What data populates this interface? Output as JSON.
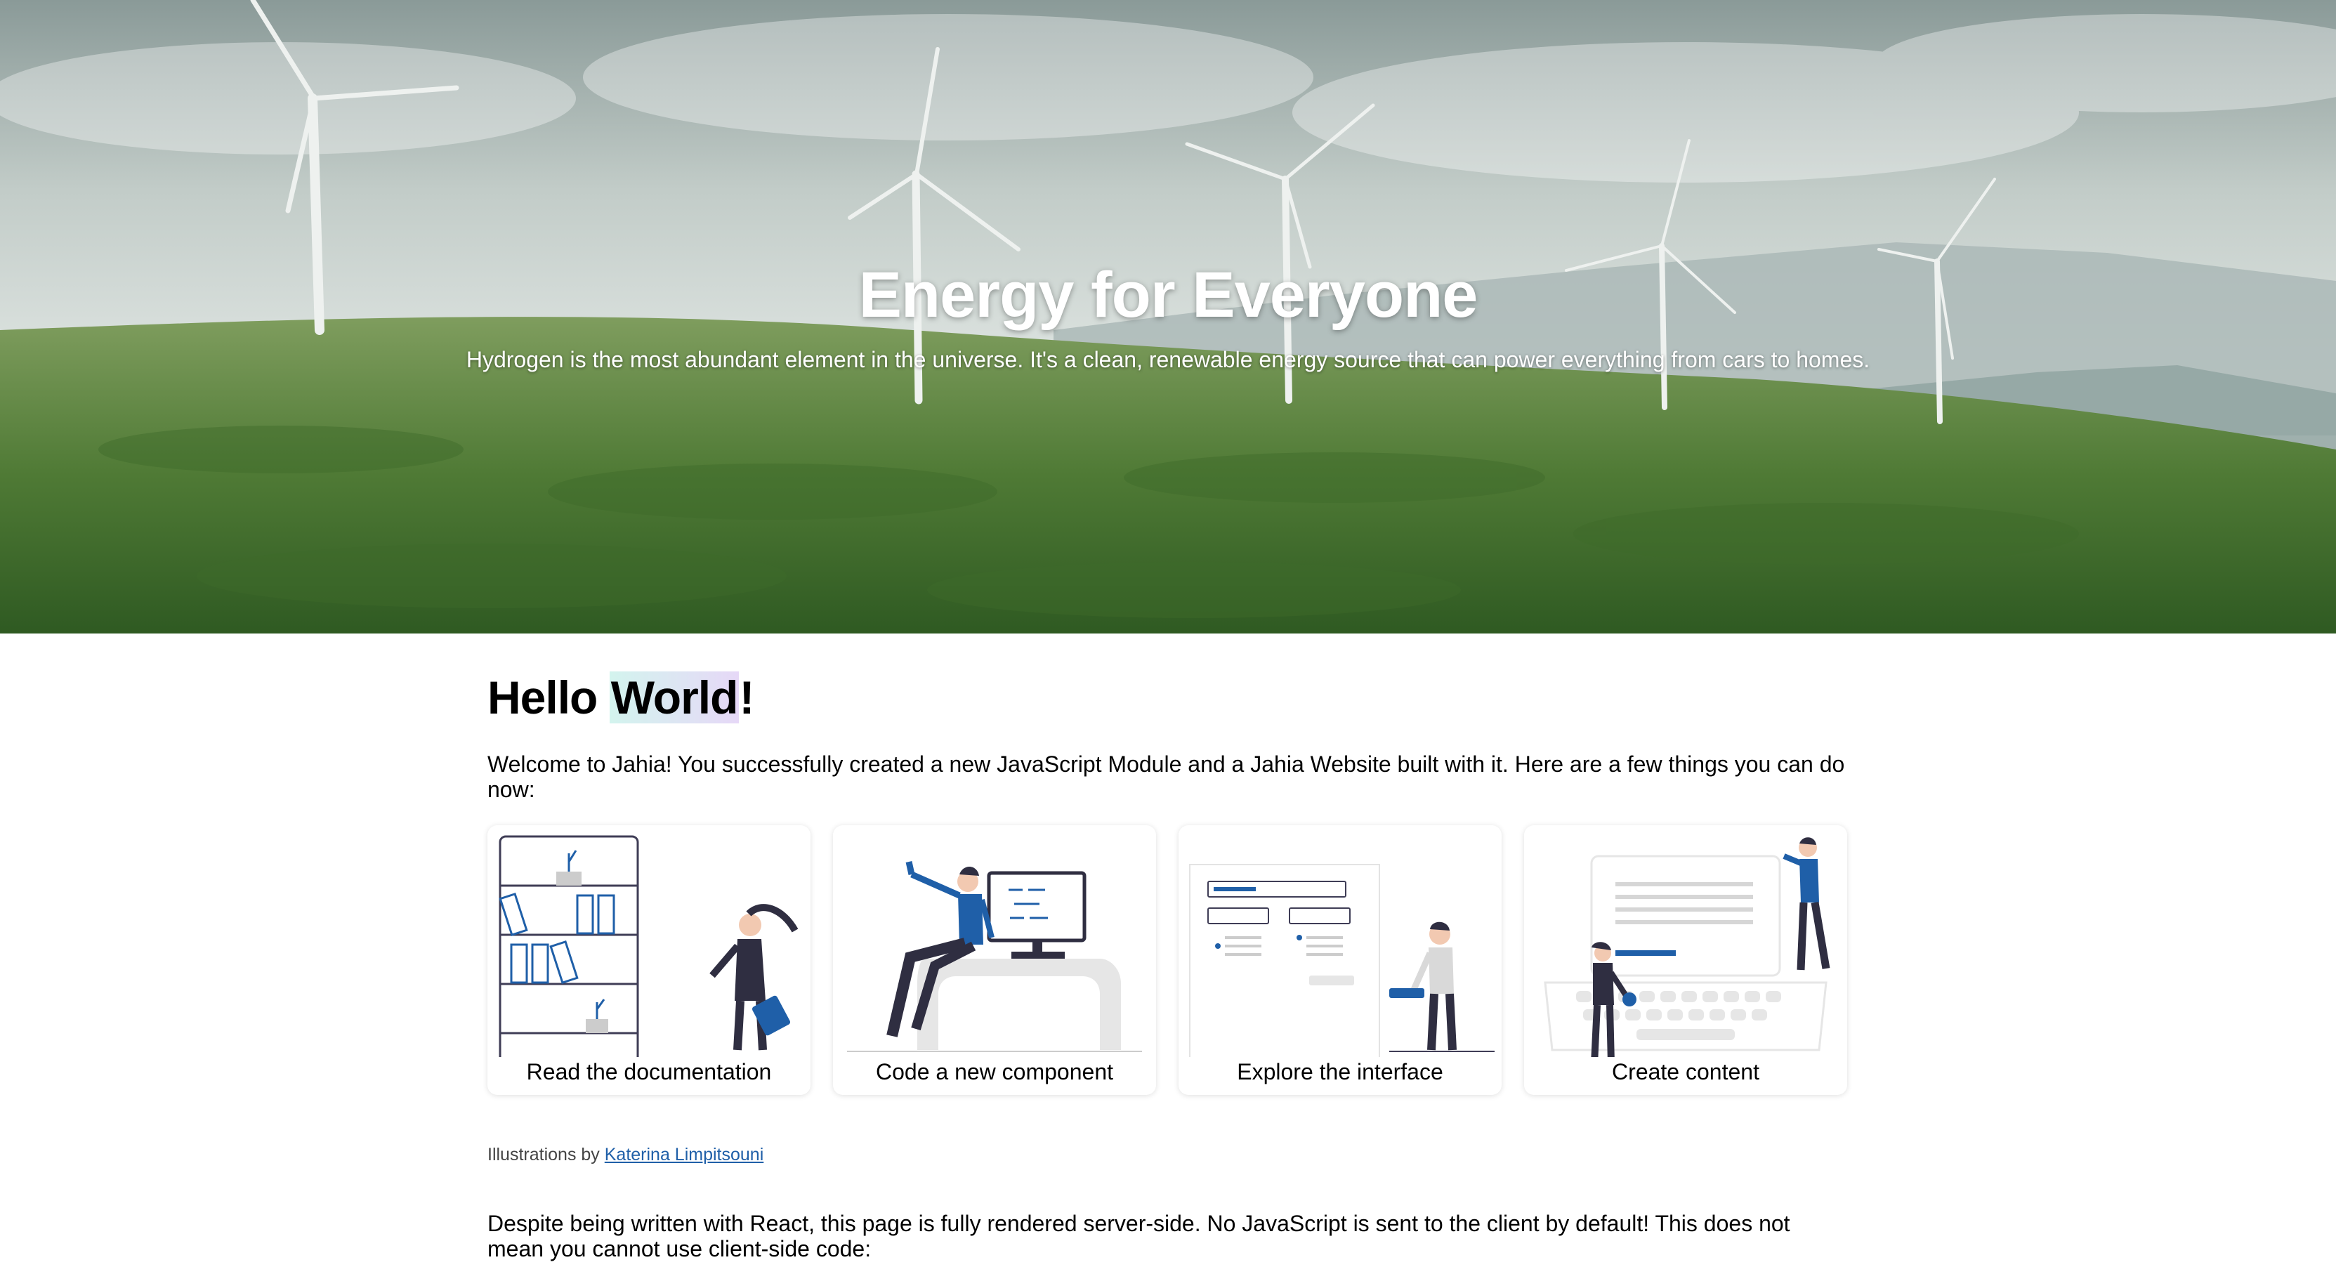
{
  "hero": {
    "title": "Energy for Everyone",
    "subtitle": "Hydrogen is the most abundant element in the universe. It's a clean, renewable energy source that can power everything from cars to homes."
  },
  "main": {
    "heading_start": "Hello ",
    "heading_highlight": "World",
    "heading_end": "!",
    "intro": "Welcome to Jahia! You successfully created a new JavaScript Module and a Jahia Website built with it. Here are a few things you can do now:",
    "cards": [
      {
        "label": "Read the documentation"
      },
      {
        "label": "Code a new component"
      },
      {
        "label": "Explore the interface"
      },
      {
        "label": "Create content"
      }
    ],
    "credit_prefix": "Illustrations by",
    "credit_link": "Katerina Limpitsouni",
    "paragraph2": "Despite being written with React, this page is fully rendered server-side. No JavaScript is sent to the client by default! This does not mean you cannot use client-side code:"
  },
  "colors": {
    "accent_blue": "#1f5fa8",
    "illustration_dark": "#2f2e41",
    "highlight_start": "#d3f4ee",
    "highlight_end": "#e6d8f7"
  }
}
